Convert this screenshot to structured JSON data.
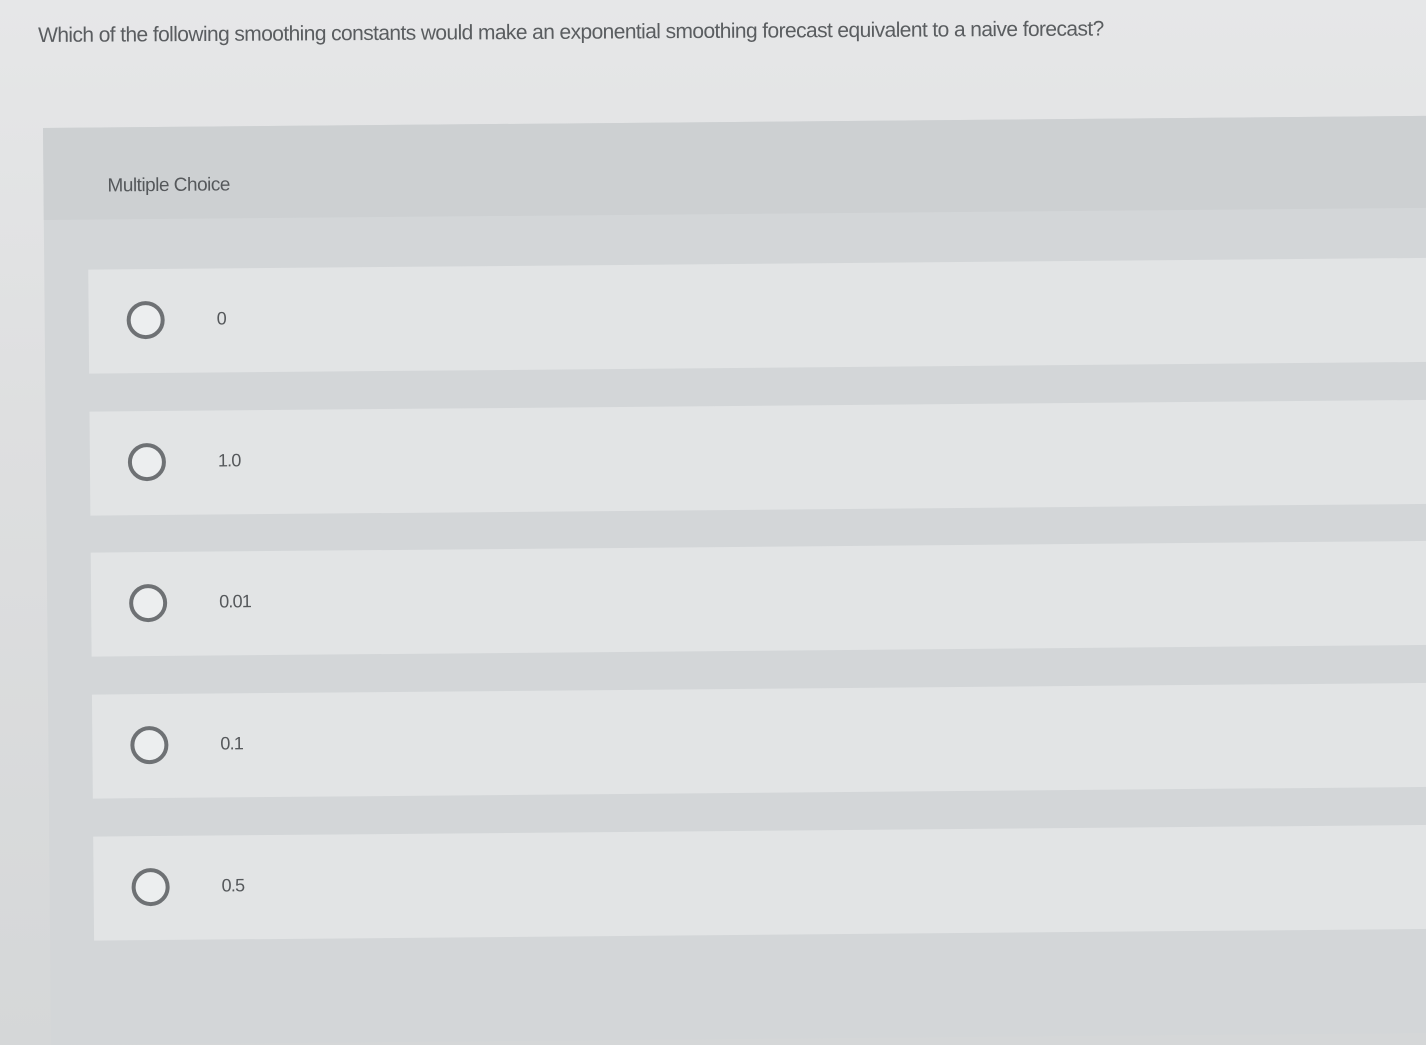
{
  "question": {
    "text": "Which of the following smoothing constants would make an exponential smoothing forecast equivalent to a naive forecast?"
  },
  "panel": {
    "title": "Multiple Choice"
  },
  "choices": [
    {
      "label": "0",
      "selected": false
    },
    {
      "label": "1.0",
      "selected": false
    },
    {
      "label": "0.01",
      "selected": false
    },
    {
      "label": "0.1",
      "selected": false
    },
    {
      "label": "0.5",
      "selected": false
    }
  ],
  "colors": {
    "background": "#dedfe0",
    "panel": "#d3d6d8",
    "choice_row": "#e2e4e5",
    "text": "#55585b",
    "radio_border": "#6e7174"
  }
}
